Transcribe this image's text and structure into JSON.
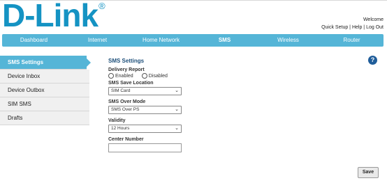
{
  "brand": {
    "logo_text": "D-Link",
    "registered": "®"
  },
  "header": {
    "welcome": "Welcome",
    "links": [
      "Quick Setup",
      "Help",
      "Log Out"
    ],
    "separator": " | "
  },
  "nav": {
    "items": [
      "Dashboard",
      "Internet",
      "Home Network",
      "SMS",
      "Wireless",
      "Router"
    ],
    "active": "SMS"
  },
  "sidebar": {
    "items": [
      "SMS Settings",
      "Device Inbox",
      "Device Outbox",
      "SIM SMS",
      "Drafts"
    ],
    "active": "SMS Settings"
  },
  "settings": {
    "title": "SMS Settings",
    "delivery_report": {
      "label": "Delivery Report",
      "options": [
        "Enabled",
        "Disabled"
      ]
    },
    "save_location": {
      "label": "SMS Save Location",
      "value": "SIM Card"
    },
    "over_mode": {
      "label": "SMS Over Mode",
      "value": "SMS Over PS"
    },
    "validity": {
      "label": "Validity",
      "value": "12 Hours"
    },
    "center_number": {
      "label": "Center Number",
      "value": ""
    }
  },
  "help_icon": "question-icon",
  "help_label": "?",
  "save_label": "Save",
  "colors": {
    "brand": "#1593c3",
    "nav": "#55b5d7",
    "title": "#1d4f7a",
    "help": "#1f5d9a"
  }
}
